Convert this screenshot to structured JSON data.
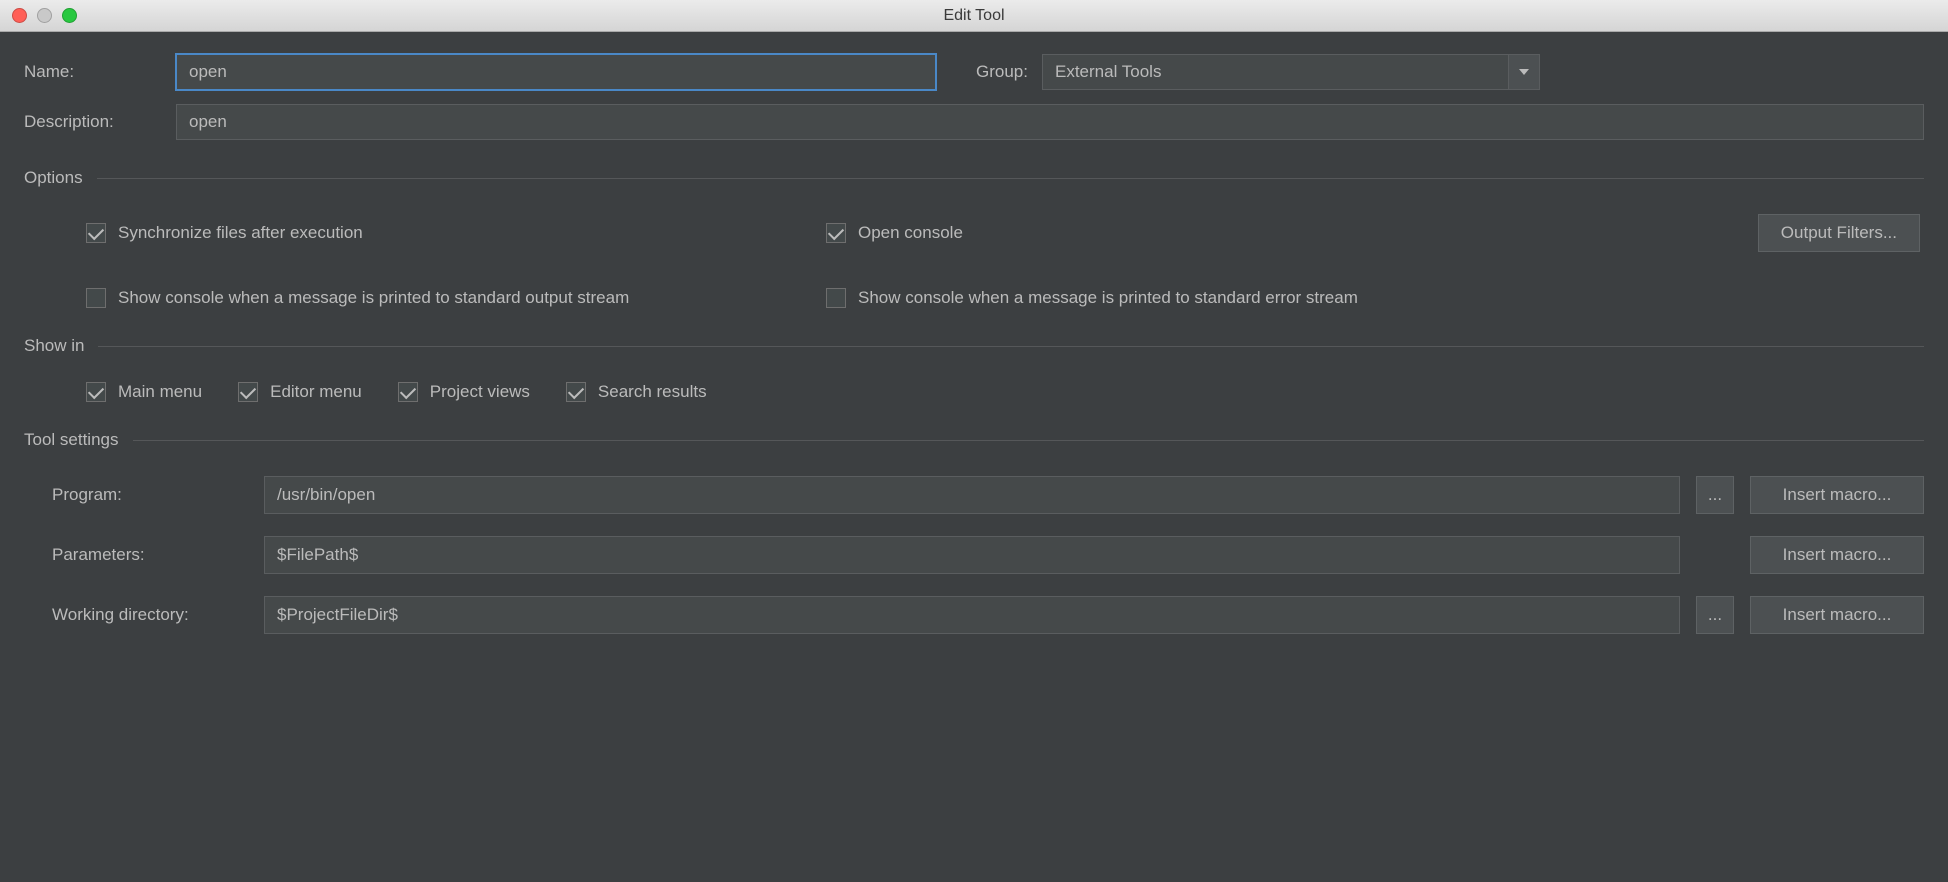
{
  "window": {
    "title": "Edit Tool"
  },
  "fields": {
    "name_label": "Name:",
    "name_value": "open",
    "group_label": "Group:",
    "group_value": "External Tools",
    "description_label": "Description:",
    "description_value": "open"
  },
  "sections": {
    "options": "Options",
    "show_in": "Show in",
    "tool_settings": "Tool settings"
  },
  "options": {
    "sync_files": "Synchronize files after execution",
    "open_console": "Open console",
    "output_filters_btn": "Output Filters...",
    "show_stdout": "Show console when a message is printed to standard output stream",
    "show_stderr": "Show console when a message is printed to standard error stream"
  },
  "show_in": {
    "main_menu": "Main menu",
    "editor_menu": "Editor menu",
    "project_views": "Project views",
    "search_results": "Search results"
  },
  "tool": {
    "program_label": "Program:",
    "program_value": "/usr/bin/open",
    "parameters_label": "Parameters:",
    "parameters_value": "$FilePath$",
    "workdir_label": "Working directory:",
    "workdir_value": "$ProjectFileDir$",
    "insert_macro_btn": "Insert macro...",
    "ellipsis": "..."
  }
}
